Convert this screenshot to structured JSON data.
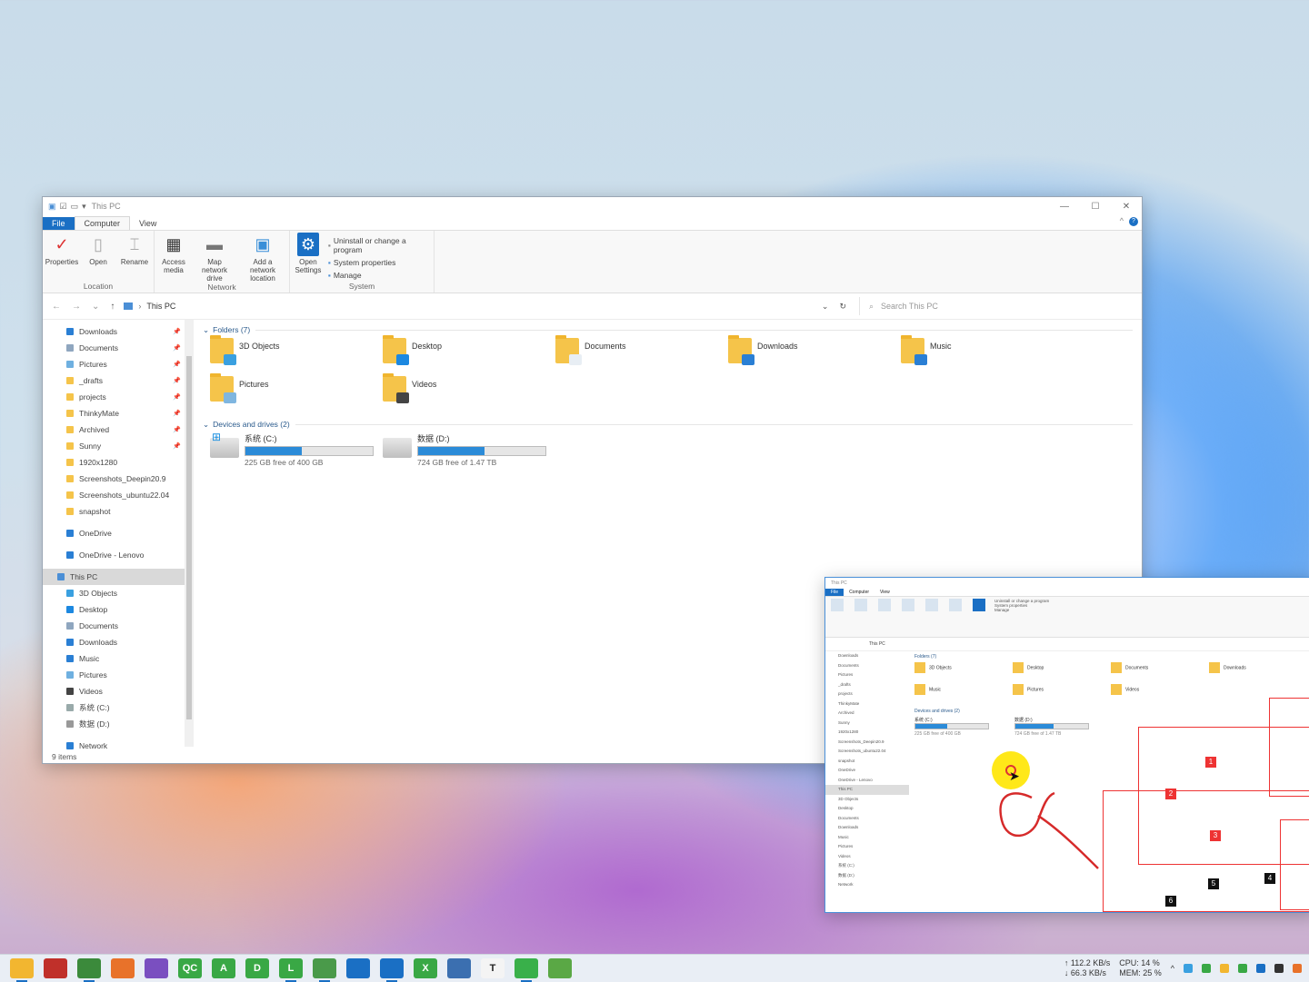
{
  "window": {
    "title": "This PC",
    "tabs": [
      "File",
      "Computer",
      "View"
    ],
    "ribbon": {
      "groups": [
        {
          "name": "Location",
          "buttons": [
            "Properties",
            "Open",
            "Rename"
          ]
        },
        {
          "name": "Network",
          "buttons": [
            "Access media",
            "Map network drive",
            "Add a network location"
          ]
        },
        {
          "name": "System",
          "buttons": [
            "Open Settings"
          ],
          "small": [
            "Uninstall or change a program",
            "System properties",
            "Manage"
          ]
        }
      ]
    },
    "address": "This PC",
    "search_placeholder": "Search This PC",
    "nav": {
      "quick": [
        {
          "label": "Downloads",
          "color": "#2a7fd4",
          "pinned": true
        },
        {
          "label": "Documents",
          "color": "#8fa6bf",
          "pinned": true
        },
        {
          "label": "Pictures",
          "color": "#6fb0e0",
          "pinned": true
        },
        {
          "label": "_drafts",
          "color": "#f5c44a",
          "pinned": true
        },
        {
          "label": "projects",
          "color": "#f5c44a",
          "pinned": true
        },
        {
          "label": "ThinkyMate",
          "color": "#f5c44a",
          "pinned": true
        },
        {
          "label": "Archived",
          "color": "#f5c44a",
          "pinned": true
        },
        {
          "label": "Sunny",
          "color": "#f5c44a",
          "pinned": true
        },
        {
          "label": "1920x1280",
          "color": "#f5c44a",
          "pinned": false
        },
        {
          "label": "Screenshots_Deepin20.9",
          "color": "#f5c44a",
          "pinned": false
        },
        {
          "label": "Screenshots_ubuntu22.04",
          "color": "#f5c44a",
          "pinned": false
        },
        {
          "label": "snapshot",
          "color": "#f5c44a",
          "pinned": false
        }
      ],
      "onedrive": [
        "OneDrive",
        "OneDrive - Lenovo"
      ],
      "thispc": "This PC",
      "pc_items": [
        "3D Objects",
        "Desktop",
        "Documents",
        "Downloads",
        "Music",
        "Pictures",
        "Videos",
        "系统 (C:)",
        "数据 (D:)"
      ],
      "network": "Network"
    },
    "folders_header": "Folders (7)",
    "folders": [
      {
        "label": "3D Objects",
        "overlay": "#3aa0e0"
      },
      {
        "label": "Desktop",
        "overlay": "#1c88e0"
      },
      {
        "label": "Documents",
        "overlay": "#e8eef4"
      },
      {
        "label": "Downloads",
        "overlay": "#2a7fd4"
      },
      {
        "label": "Music",
        "overlay": "#2a7fd4"
      },
      {
        "label": "Pictures",
        "overlay": "#7fb6e0"
      },
      {
        "label": "Videos",
        "overlay": "#444"
      }
    ],
    "drives_header": "Devices and drives (2)",
    "drives": [
      {
        "label": "系统 (C:)",
        "free": "225 GB free of 400 GB",
        "used_fraction": 0.44
      },
      {
        "label": "数据 (D:)",
        "free": "724 GB free of 1.47 TB",
        "used_fraction": 0.52
      }
    ],
    "status": "9 items"
  },
  "annotations": {
    "tags": [
      "1",
      "2",
      "3",
      "4",
      "5",
      "6"
    ]
  },
  "taskbar": {
    "apps": [
      {
        "name": "file-explorer",
        "color": "#f2b630",
        "glyph": "",
        "active": true
      },
      {
        "name": "app-red",
        "color": "#c0302a",
        "glyph": "",
        "active": false
      },
      {
        "name": "chrome",
        "color": "#3b8a3b",
        "glyph": "",
        "active": true
      },
      {
        "name": "firefox",
        "color": "#e8722a",
        "glyph": "",
        "active": false
      },
      {
        "name": "visual-studio",
        "color": "#7a4fc0",
        "glyph": "",
        "active": false
      },
      {
        "name": "qc",
        "color": "#39a845",
        "glyph": "QC",
        "active": false
      },
      {
        "name": "app-a",
        "color": "#39a845",
        "glyph": "A",
        "active": false
      },
      {
        "name": "app-d",
        "color": "#39a845",
        "glyph": "D",
        "active": false
      },
      {
        "name": "app-l",
        "color": "#39a845",
        "glyph": "L",
        "active": true
      },
      {
        "name": "app-chart",
        "color": "#4a9a4a",
        "glyph": "",
        "active": true
      },
      {
        "name": "app-search",
        "color": "#1a6fc4",
        "glyph": "",
        "active": false
      },
      {
        "name": "app-window",
        "color": "#1a6fc4",
        "glyph": "",
        "active": true
      },
      {
        "name": "app-x",
        "color": "#39a845",
        "glyph": "X",
        "active": false
      },
      {
        "name": "app-network",
        "color": "#3b6fb0",
        "glyph": "",
        "active": false
      },
      {
        "name": "app-t",
        "color": "#f4f4f4",
        "glyph": "T",
        "active": false
      },
      {
        "name": "wechat",
        "color": "#39b04a",
        "glyph": "",
        "active": true
      },
      {
        "name": "app-green",
        "color": "#5aa845",
        "glyph": "",
        "active": false
      }
    ],
    "net_up": "↑ 112.2 KB/s",
    "net_down": "↓ 66.3 KB/s",
    "cpu": "CPU: 14 %",
    "mem": "MEM: 25 %"
  }
}
